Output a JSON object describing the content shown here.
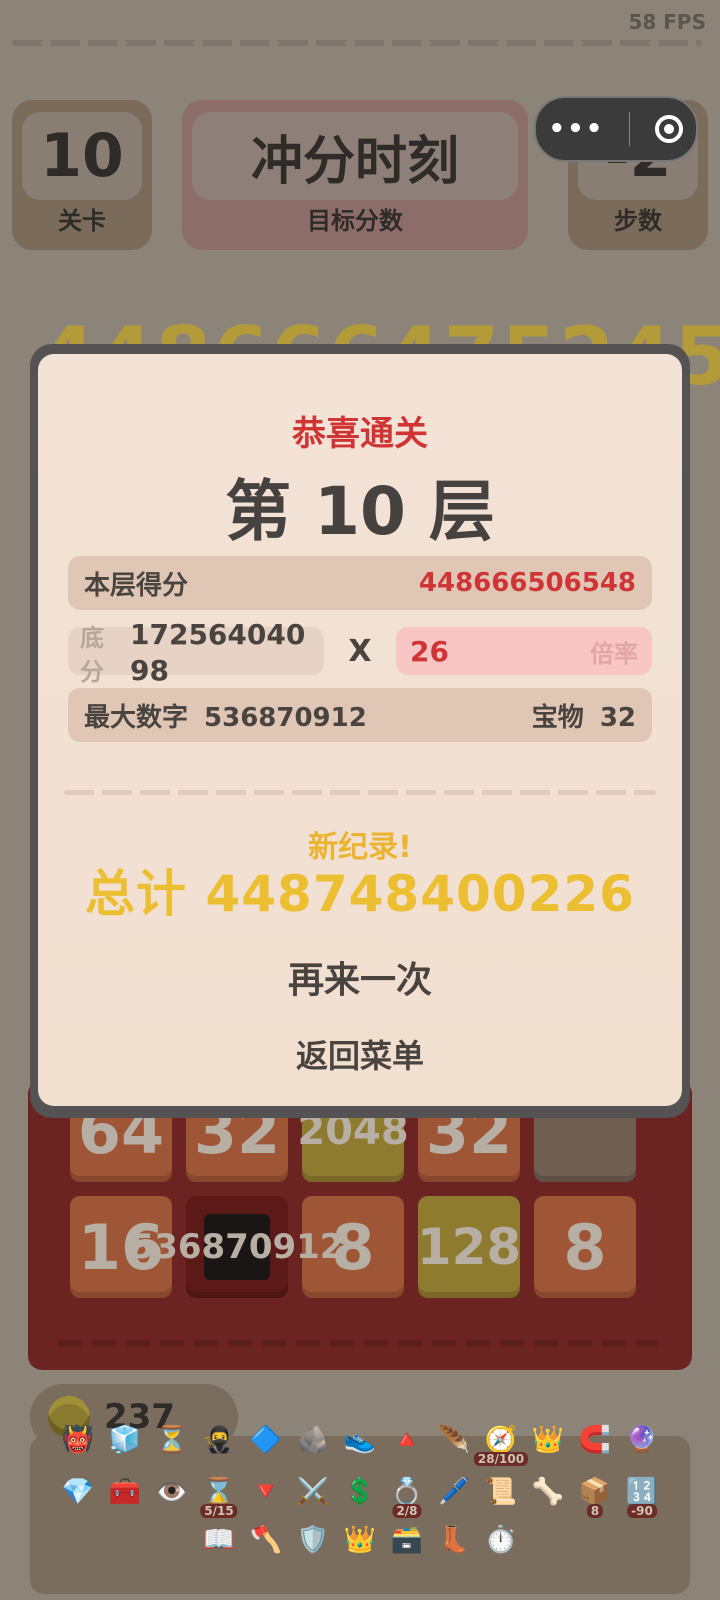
{
  "hud": {
    "fps": "58 FPS",
    "level_value": "10",
    "level_label": "关卡",
    "target_title": "冲分时刻",
    "target_label": "目标分数",
    "steps_value": "-2",
    "steps_label": "步数",
    "background_score": "448666475245"
  },
  "capsule": {
    "more_glyph": "•••"
  },
  "board": {
    "tiles": [
      {
        "value": "64",
        "color": "orange"
      },
      {
        "value": "32",
        "color": "orange"
      },
      {
        "value": "2048",
        "color": "yellow"
      },
      {
        "value": "32",
        "color": "orange"
      },
      {
        "value": "",
        "color": "empty"
      },
      {
        "value": "16",
        "color": "orange"
      },
      {
        "value": "536870912",
        "color": "monster"
      },
      {
        "value": "8",
        "color": "orange"
      },
      {
        "value": "128",
        "color": "yellow"
      },
      {
        "value": "8",
        "color": "orange"
      }
    ]
  },
  "coins": {
    "value": "237"
  },
  "inventory": {
    "row1": [
      "👹",
      "🧊",
      "⏳",
      "🥷",
      "🔷",
      "🪨",
      "👟",
      "🔺",
      "🪶",
      "🧭",
      "👑",
      "🧲",
      "🔮"
    ],
    "row2": [
      "💎",
      "🧰",
      "👁️",
      "⌛",
      "🔻",
      "⚔️",
      "💲",
      "💍",
      "🖊️",
      "📜",
      "🦴",
      "📦",
      "🔢"
    ],
    "row3": [
      "📖",
      "🪓",
      "🛡️",
      "👑",
      "🗃️",
      "👢",
      "⏱️"
    ],
    "badges": {
      "compass": "28/100",
      "hourglass": "5/15",
      "ring": "2/8",
      "box": "8",
      "counter": "-90"
    }
  },
  "modal": {
    "congrats": "恭喜通关",
    "level_title": "第 10 层",
    "level_score_label": "本层得分",
    "level_score_value": "448666506548",
    "base_label": "底分",
    "base_value": "17256404098",
    "times": "X",
    "multiplier_value": "26",
    "multiplier_label": "倍率",
    "max_number_label": "最大数字",
    "max_number_value": "536870912",
    "treasure_label": "宝物",
    "treasure_value": "32",
    "new_record": "新纪录!",
    "total": "总计 448748400226",
    "retry_button": "再来一次",
    "menu_button": "返回菜单"
  },
  "colors": {
    "accent_red": "#d03535",
    "gold": "#ecbf32",
    "modal_bg": "#f3e3d6"
  }
}
